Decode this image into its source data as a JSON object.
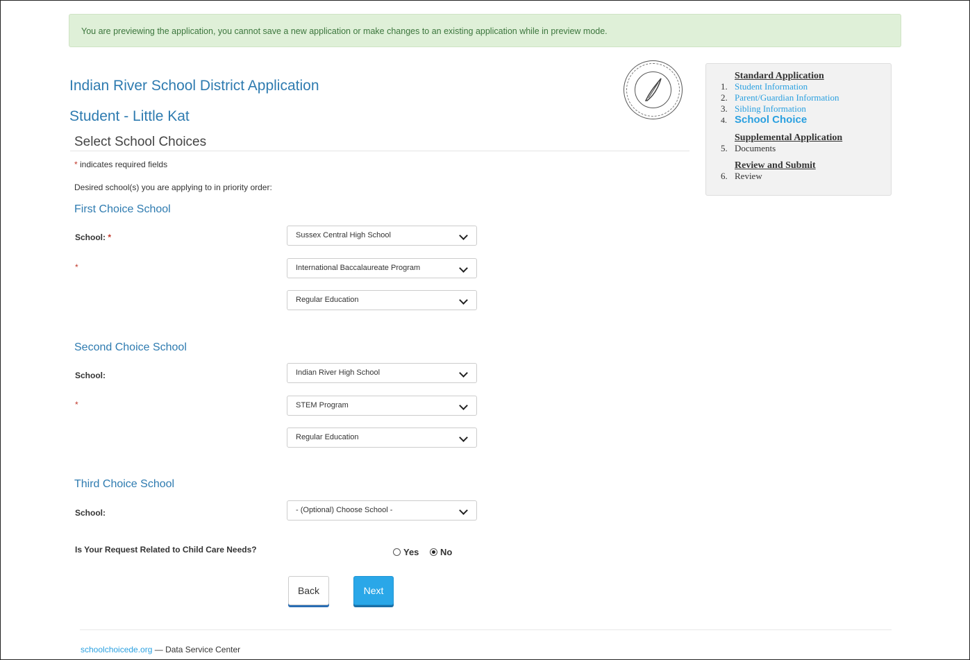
{
  "alert": {
    "text": "You are previewing the application, you cannot save a new application or make changes to an existing application while in preview mode."
  },
  "header": {
    "app_title": "Indian River School District Application",
    "student": "Student - Little Kat",
    "section_title": "Select School Choices",
    "logo_icon": "school-district-seal-icon"
  },
  "form": {
    "required_star": "*",
    "required_note": " indicates required fields",
    "desired_text": "Desired school(s) you are applying to in priority order:",
    "school_label": "School:",
    "first": {
      "heading": "First Choice School",
      "school": "Sussex Central High School",
      "program": "International Baccalaureate Program",
      "education": "Regular Education"
    },
    "second": {
      "heading": "Second Choice School",
      "school": "Indian River High School",
      "program": "STEM Program",
      "education": "Regular Education"
    },
    "third": {
      "heading": "Third Choice School",
      "school": "- (Optional) Choose School -"
    },
    "child_care": {
      "question": "Is Your Request Related to Child Care Needs?",
      "yes_label": "Yes",
      "no_label": "No",
      "selected": "No"
    },
    "back_label": "Back",
    "next_label": "Next"
  },
  "sidebar": {
    "standard_heading": "Standard Application",
    "supplemental_heading": "Supplemental Application",
    "review_heading": "Review and Submit",
    "items": [
      {
        "num": "1.",
        "label": "Student Information"
      },
      {
        "num": "2.",
        "label": "Parent/Guardian Information"
      },
      {
        "num": "3.",
        "label": "Sibling Information"
      },
      {
        "num": "4.",
        "label": "School Choice"
      },
      {
        "num": "5.",
        "label": "Documents"
      },
      {
        "num": "6.",
        "label": "Review"
      }
    ]
  },
  "footer": {
    "link": "schoolchoicede.org",
    "text": " — Data Service Center"
  },
  "colors": {
    "accent": "#2e7bb0",
    "link": "#2aa0e0",
    "alert_bg": "#dff0d8",
    "alert_text": "#3c763d",
    "required": "#c0392b",
    "next_button": "#2aa7e8"
  }
}
